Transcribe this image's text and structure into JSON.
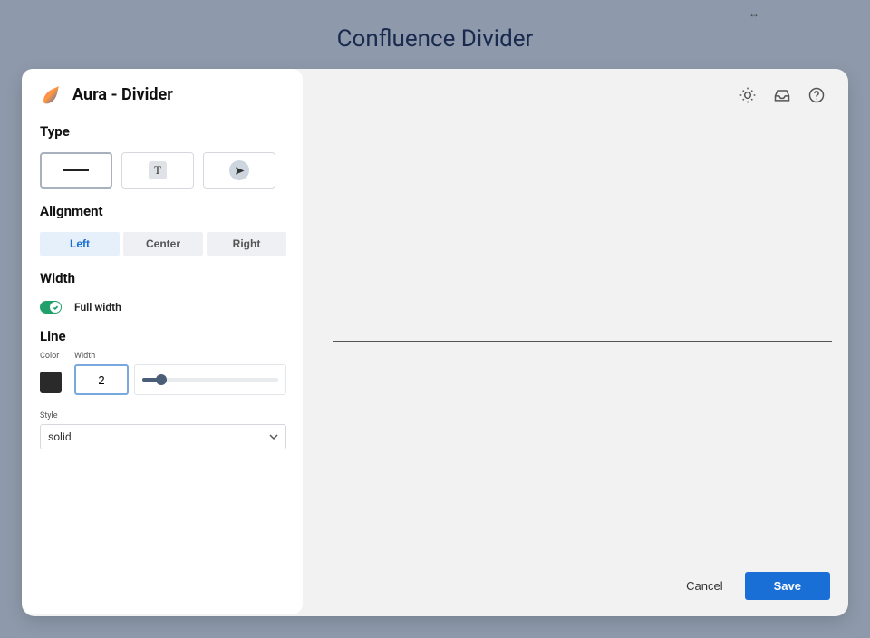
{
  "page": {
    "header": "Confluence Divider",
    "swap_icon_label": "↔"
  },
  "sidebar": {
    "title": "Aura - Divider",
    "sections": {
      "type": {
        "label": "Type",
        "options": [
          "line",
          "text",
          "send"
        ],
        "selected": "line",
        "text_glyph": "T"
      },
      "alignment": {
        "label": "Alignment",
        "options": {
          "left": "Left",
          "center": "Center",
          "right": "Right"
        },
        "selected": "left"
      },
      "width": {
        "label": "Width",
        "full_width_label": "Full width",
        "full_width_on": true
      },
      "line": {
        "label": "Line",
        "color_label": "Color",
        "color_value": "#2a2a2a",
        "width_label": "Width",
        "width_value": "2",
        "style_label": "Style",
        "style_value": "solid"
      }
    }
  },
  "main": {
    "icons": {
      "sun": "sun-icon",
      "inbox": "inbox-icon",
      "help": "help-icon"
    }
  },
  "footer": {
    "cancel": "Cancel",
    "save": "Save"
  }
}
